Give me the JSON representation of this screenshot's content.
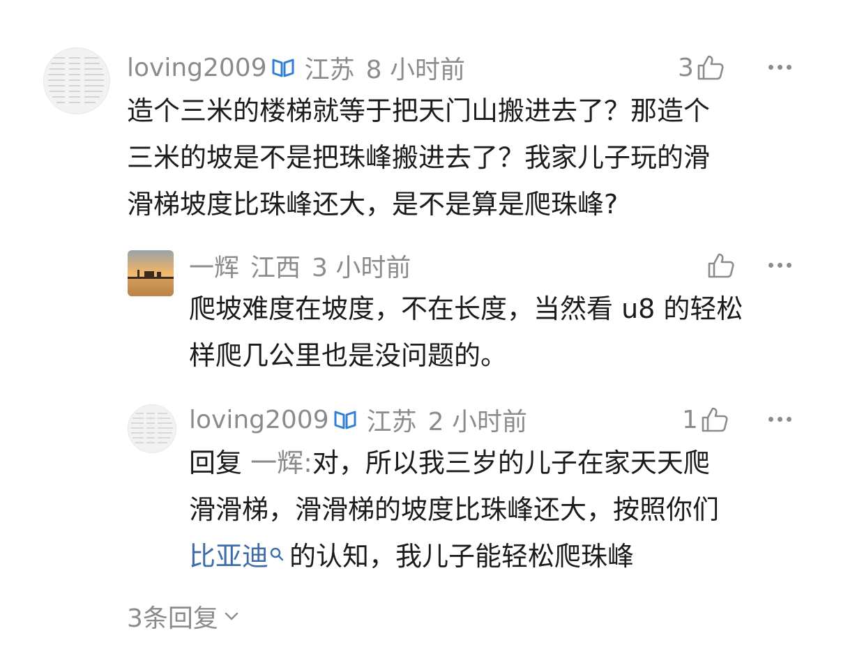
{
  "comments": [
    {
      "user": "loving2009",
      "location": "江苏",
      "time": "8 小时前",
      "likes": "3",
      "lines": [
        "造个三米的楼梯就等于把天门山搬进去了？那造个",
        "三米的坡是不是把珠峰搬进去了？我家儿子玩的滑",
        "滑梯坡度比珠峰还大，是不是算是爬珠峰?"
      ]
    }
  ],
  "replies": [
    {
      "user": "一辉",
      "location": "江西",
      "time": "3 小时前",
      "likes": "",
      "lines": [
        "爬坡难度在坡度，不在长度，当然看 u8 的轻松",
        "样爬几公里也是没问题的。"
      ]
    },
    {
      "user": "loving2009",
      "location": "江苏",
      "time": "2 小时前",
      "likes": "1",
      "reply_prefix": "回复",
      "reply_target": "一辉:",
      "line1_rest": "对，所以我三岁的儿子在家天天爬",
      "line2": "滑滑梯，滑滑梯的坡度比珠峰还大，按照你们",
      "link_text": "比亚迪",
      "line3_rest": "的认知，我儿子能轻松爬珠峰"
    }
  ],
  "footer": {
    "more_replies": "3条回复"
  },
  "colors": {
    "meta_gray": "#8b8b8b",
    "text": "#1b1b1b",
    "link_blue": "#3e6baa",
    "vip_blue": "#2f7fd6"
  },
  "icons": {
    "vip": "vip-badge-icon",
    "like": "thumbs-up-icon",
    "more": "more-dots-icon",
    "search": "search-icon",
    "chevron": "chevron-down-icon"
  }
}
